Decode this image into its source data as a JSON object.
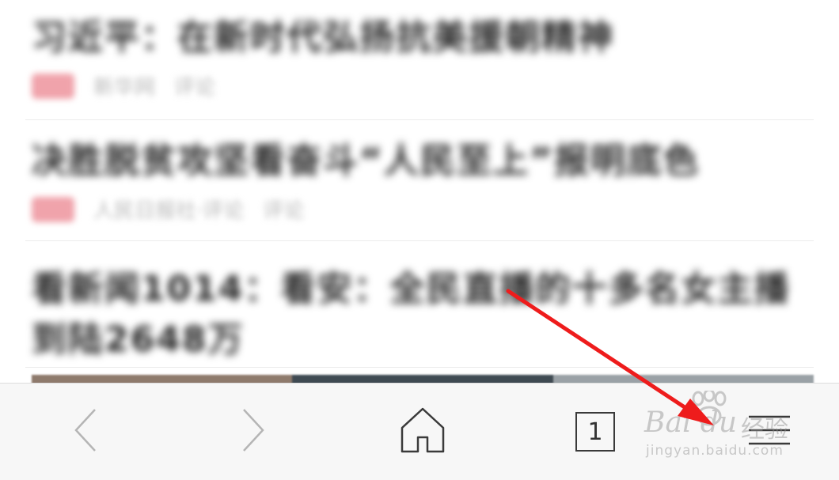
{
  "feed": {
    "items": [
      {
        "title": "习近平：在新时代弘扬抗美援朝精神",
        "source": "新华网",
        "comments": "评论"
      },
      {
        "title": "决胜脱贫攻坚看奋斗“人民至上”报明底色",
        "source": "人民日报社·评论",
        "comments": "评论"
      },
      {
        "title": "看新闻1014：看安：全民直播的十多名女主播到陆2648万"
      }
    ],
    "image_strip_colors": [
      "#8e7a6c",
      "#3f4a52",
      "#9aa1a6"
    ]
  },
  "toolbar": {
    "tab_count": "1",
    "icons": [
      "back-chevron-icon",
      "forward-chevron-icon",
      "home-icon",
      "tabs-icon",
      "menu-icon"
    ]
  },
  "watermark": {
    "brand": "Bai du",
    "cn": "经验",
    "url": "jingyan.baidu.com"
  },
  "colors": {
    "toolbar_bg": "#f7f7f7",
    "tag": "#f0a3ab",
    "arrow": "#ee1c1c"
  }
}
